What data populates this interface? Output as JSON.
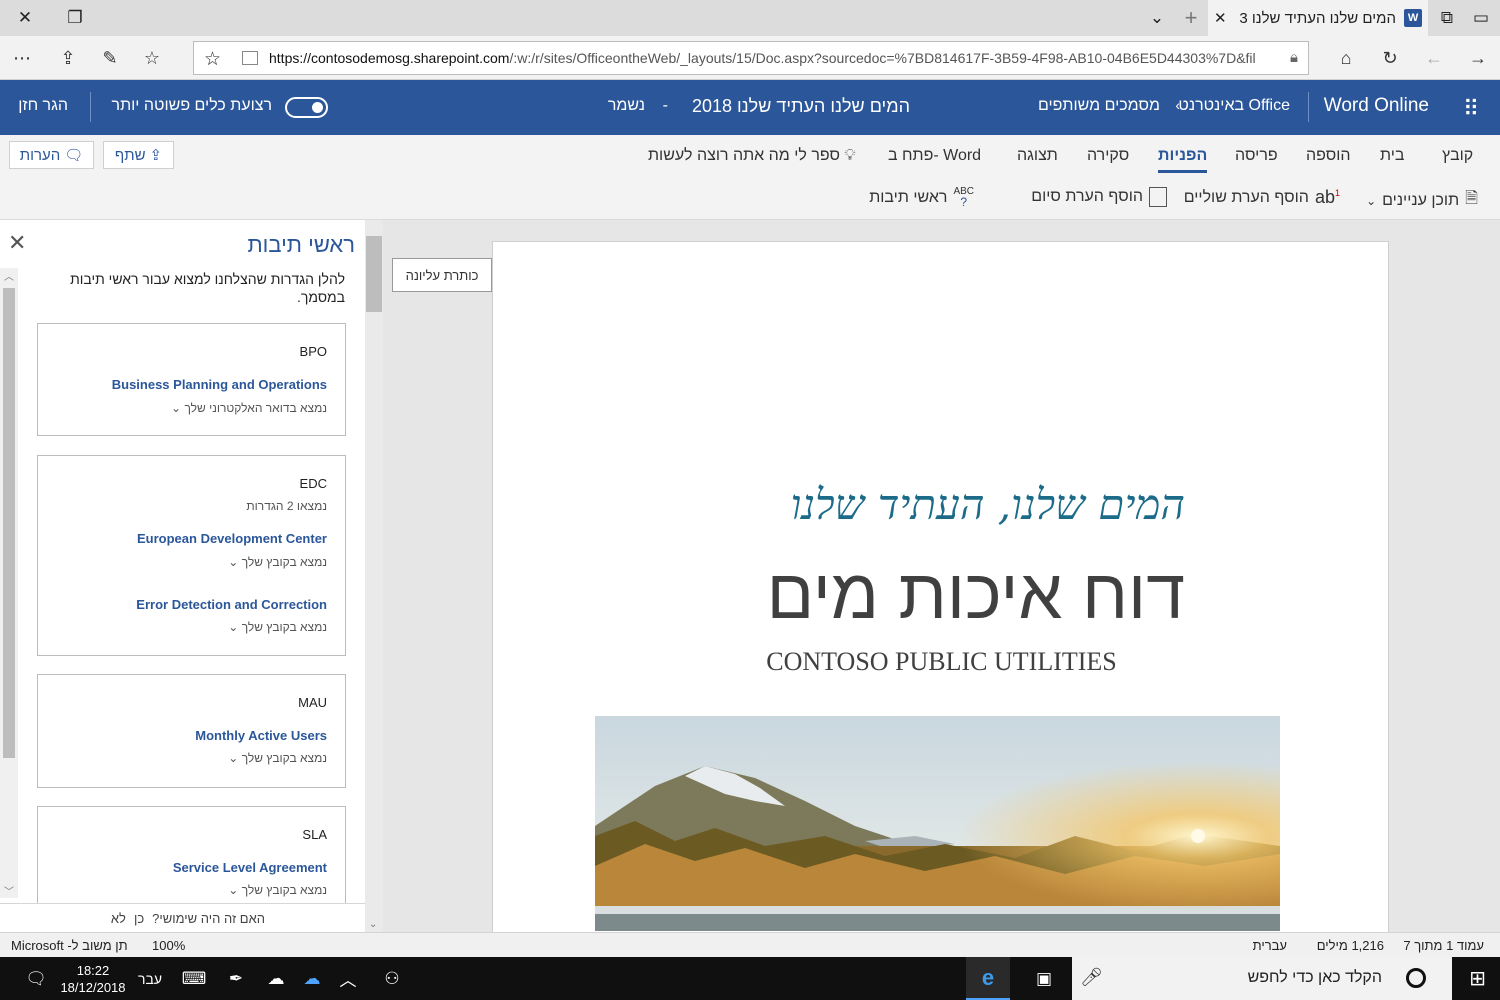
{
  "browser": {
    "tab_title": "המים שלנו העתיד שלנו 3",
    "url_domain": "https://contosodemosg.sharepoint.com",
    "url_path": "/:w:/r/sites/OfficeontheWeb/_layouts/15/Doc.aspx?sourcedoc=%7BD814617F-3B59-4F98-AB10-04B6E5D44303%7D&fil"
  },
  "office_header": {
    "app_name": "Word Online",
    "breadcrumb_root": "Office באינטרנט",
    "breadcrumb_folder": "מסמכים משותפים",
    "doc_title": "המים שלנו העתיד שלנו 2018",
    "separator": "-",
    "saved_status": "נשמר",
    "simplified_ribbon_label": "רצועת כלים פשוטה יותר",
    "user_name": "הגר חזן"
  },
  "ribbon": {
    "tabs": [
      "קובץ",
      "בית",
      "הוספה",
      "פריסה",
      "הפניות",
      "סקירה",
      "תצוגה",
      "פתח ב- Word"
    ],
    "active_tab": "הפניות",
    "tell_me": "ספר לי מה אתה רוצה לעשות",
    "share_label": "שתף",
    "comments_label": "הערות",
    "commands": {
      "toc": "תוכן עניינים",
      "footnote": "הוסף הערת שוליים",
      "endnote": "הוסף הערת סיום",
      "acronyms": "ראשי תיבות"
    }
  },
  "pane": {
    "title": "ראשי תיבות",
    "intro": "להלן הגדרות שהצלחנו למצוא עבור ראשי תיבות במסמך.",
    "cards": [
      {
        "abbr": "BPO",
        "defs": [
          {
            "text": "Business Planning and Operations",
            "source": "נמצא בדואר האלקטרוני שלך"
          }
        ]
      },
      {
        "abbr": "EDC",
        "subtitle": "נמצאו 2 הגדרות",
        "defs": [
          {
            "text": "European Development Center",
            "source": "נמצא בקובץ שלך"
          },
          {
            "text": "Error Detection and Correction",
            "source": "נמצא בקובץ שלך"
          }
        ]
      },
      {
        "abbr": "MAU",
        "defs": [
          {
            "text": "Monthly Active Users",
            "source": "נמצא בקובץ שלך"
          }
        ]
      },
      {
        "abbr": "SLA",
        "defs": [
          {
            "text": "Service Level Agreement",
            "source": "נמצא בקובץ שלך"
          }
        ]
      }
    ],
    "feedback_q": "האם זה היה שימושי?",
    "feedback_yes": "כן",
    "feedback_no": "לא"
  },
  "document": {
    "header_tag": "כותרת עליונה",
    "subtitle": "המים שלנו, העתיד שלנו",
    "title": "דוח איכות מים",
    "org": "CONTOSO PUBLIC UTILITIES"
  },
  "status_bar": {
    "page": "עמוד 1 מתוך 7",
    "words": "1,216 מילים",
    "language": "עברית",
    "zoom": "100%",
    "feedback": "תן משוב ל- Microsoft"
  },
  "taskbar": {
    "search_placeholder": "הקלד כאן כדי לחפש",
    "time": "18:22",
    "date": "18/12/2018",
    "lang": "עבר"
  },
  "colors": {
    "office_blue": "#2b579a",
    "doc_teal": "#1c6b89",
    "taskbar": "#101010"
  }
}
